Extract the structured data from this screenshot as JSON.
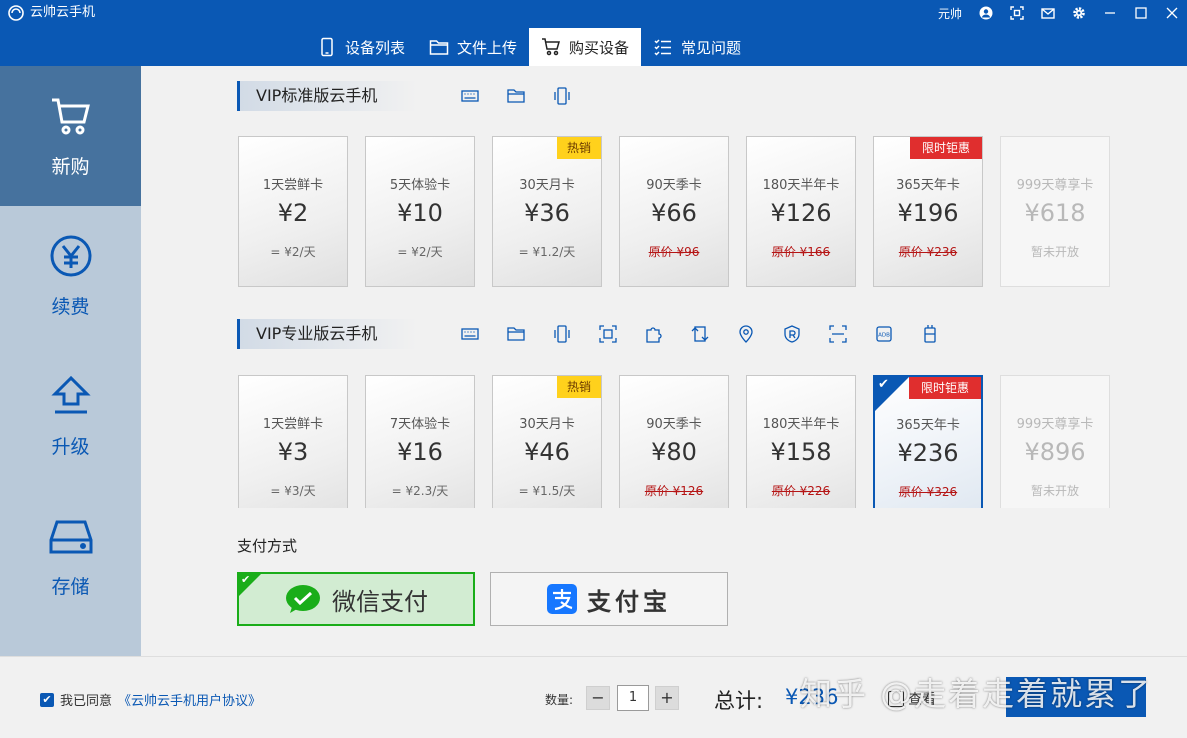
{
  "app": {
    "title": "云帅云手机",
    "user": "元帅"
  },
  "tabs": [
    {
      "label": "设备列表",
      "icon": "phone-icon"
    },
    {
      "label": "文件上传",
      "icon": "folder-icon"
    },
    {
      "label": "购买设备",
      "icon": "cart-icon"
    },
    {
      "label": "常见问题",
      "icon": "faq-list-icon"
    }
  ],
  "sidebar": [
    {
      "label": "新购",
      "icon": "cart-icon"
    },
    {
      "label": "续费",
      "icon": "yen-circle-icon"
    },
    {
      "label": "升级",
      "icon": "upload-arrow-icon"
    },
    {
      "label": "存储",
      "icon": "drive-icon"
    }
  ],
  "standard": {
    "title": "VIP标准版云手机",
    "feature_icons": [
      "keyboard-icon",
      "folder-icon",
      "phone-vibrate-icon"
    ],
    "cards": [
      {
        "name": "1天尝鲜卡",
        "price": "¥2",
        "note": "= ¥2/天"
      },
      {
        "name": "5天体验卡",
        "price": "¥10",
        "note": "= ¥2/天"
      },
      {
        "name": "30天月卡",
        "price": "¥36",
        "note": "= ¥1.2/天",
        "badge": "热销"
      },
      {
        "name": "90天季卡",
        "price": "¥66",
        "note": "原价 ¥96"
      },
      {
        "name": "180天半年卡",
        "price": "¥126",
        "note": "原价 ¥166"
      },
      {
        "name": "365天年卡",
        "price": "¥196",
        "note": "原价 ¥236",
        "badge": "限时钜惠"
      },
      {
        "name": "999天尊享卡",
        "price": "¥618",
        "note": "暂未开放"
      }
    ]
  },
  "pro": {
    "title": "VIP专业版云手机",
    "feature_icons": [
      "keyboard-icon",
      "folder-icon",
      "phone-vibrate-icon",
      "screenshot-icon",
      "puzzle-icon",
      "rotate-icon",
      "location-icon",
      "root-shield-icon",
      "scan-icon",
      "adb-icon",
      "device-icon"
    ],
    "cards": [
      {
        "name": "1天尝鲜卡",
        "price": "¥3",
        "note": "= ¥3/天"
      },
      {
        "name": "7天体验卡",
        "price": "¥16",
        "note": "= ¥2.3/天"
      },
      {
        "name": "30天月卡",
        "price": "¥46",
        "note": "= ¥1.5/天",
        "badge": "热销"
      },
      {
        "name": "90天季卡",
        "price": "¥80",
        "note": "原价 ¥126"
      },
      {
        "name": "180天半年卡",
        "price": "¥158",
        "note": "原价 ¥226"
      },
      {
        "name": "365天年卡",
        "price": "¥236",
        "note": "原价 ¥326",
        "badge": "限时钜惠"
      },
      {
        "name": "999天尊享卡",
        "price": "¥896",
        "note": "暂未开放"
      }
    ]
  },
  "payment": {
    "title": "支付方式",
    "wechat": "微信支付",
    "alipay": "支付宝"
  },
  "footer": {
    "agree_text": "我已同意",
    "agreement_link": "《云帅云手机用户协议》",
    "qty_label": "数量:",
    "qty_minus": "−",
    "qty_value": "1",
    "qty_plus": "+",
    "total_label": "总计:",
    "total_value": "¥236",
    "view_link": "查看",
    "watermark": "知乎 @走着走着就累了"
  },
  "colors": {
    "brand": "#0a58b4",
    "hot": "#ffd11c",
    "limited": "#e02e2e",
    "wechat": "#1aad19",
    "alipay": "#1677ff"
  }
}
